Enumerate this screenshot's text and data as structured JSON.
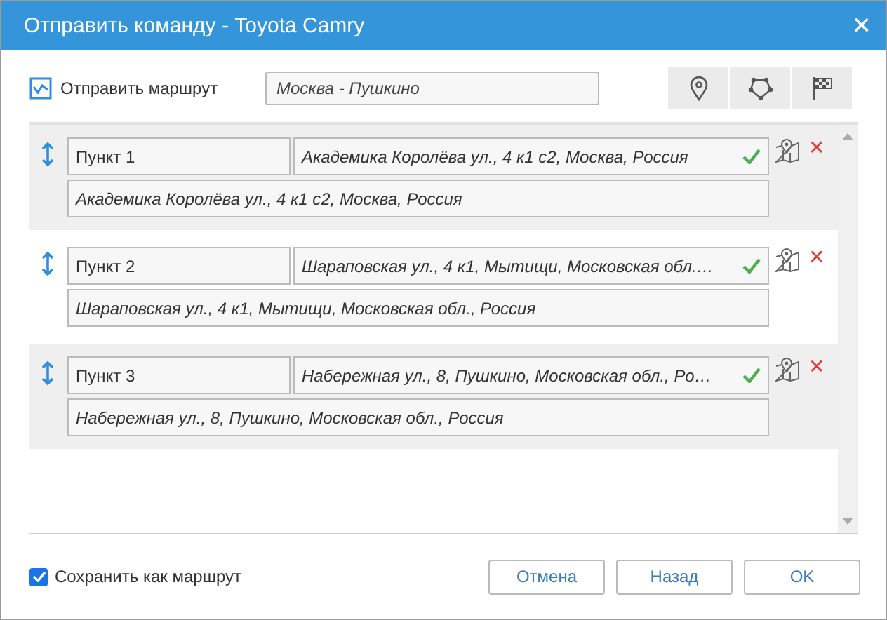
{
  "window": {
    "title": "Отправить команду - Toyota Camry",
    "close": "✕"
  },
  "route_option": {
    "label": "Отправить маршрут",
    "route_name": "Москва - Пушкино"
  },
  "points": [
    {
      "name": "Пункт 1",
      "address": "Академика Королёва ул., 4 к1 с2, Москва, Россия",
      "full_address": "Академика Королёва ул., 4 к1 с2, Москва, Россия",
      "verified": true,
      "remove": "✕"
    },
    {
      "name": "Пункт 2",
      "address": "Шараповская ул., 4 к1, Мытищи, Московская обл.…",
      "full_address": "Шараповская ул., 4 к1, Мытищи, Московская обл., Россия",
      "verified": true,
      "remove": "✕"
    },
    {
      "name": "Пункт 3",
      "address": "Набережная ул., 8, Пушкино, Московская обл., Ро…",
      "full_address": "Набережная ул., 8, Пушкино, Московская обл., Россия",
      "verified": true,
      "remove": "✕"
    }
  ],
  "save_as_route": {
    "label": "Сохранить как маршрут",
    "checked": true
  },
  "buttons": [
    "Отмена",
    "Назад",
    "OK"
  ]
}
